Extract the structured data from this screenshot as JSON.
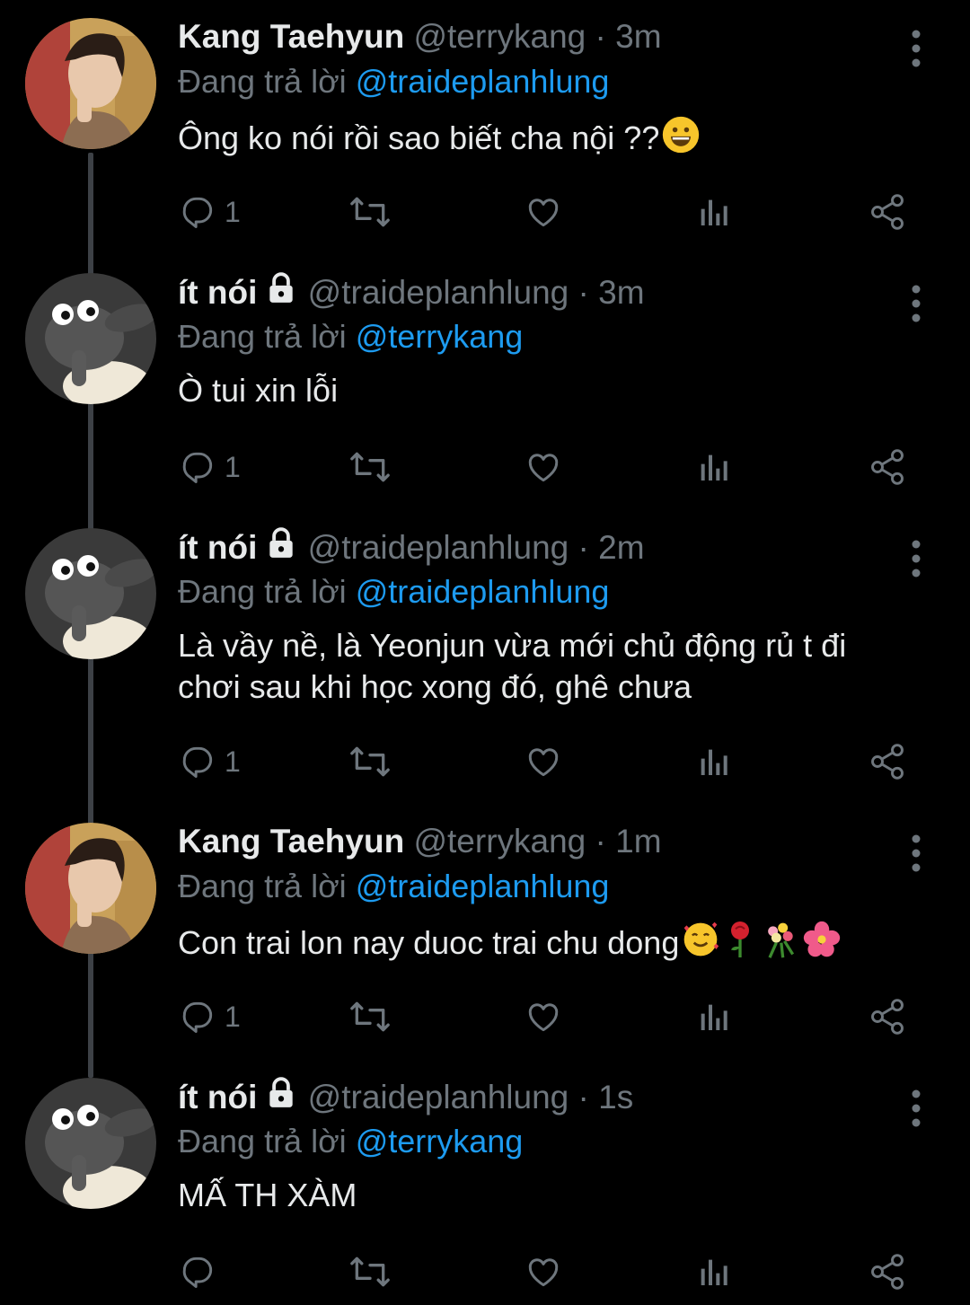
{
  "replying_prefix": "Đang trả lời",
  "tweets": [
    {
      "name": "Kang Taehyun",
      "handle": "@terrykang",
      "time": "3m",
      "replying_to": "@traideplanhlung",
      "text": "Ông ko nói rồi sao biết cha nội ??",
      "reply_count": "1",
      "avatar": "person",
      "locked": false,
      "emojis": [
        "grinning-emoji"
      ]
    },
    {
      "name": "ít nói",
      "handle": "@traideplanhlung",
      "time": "3m",
      "replying_to": "@terrykang",
      "text": "Ò tui xin lỗi",
      "reply_count": "1",
      "avatar": "sheep",
      "locked": true,
      "emojis": []
    },
    {
      "name": "ít nói",
      "handle": "@traideplanhlung",
      "time": "2m",
      "replying_to": "@traideplanhlung",
      "text": "Là vầy nề, là Yeonjun vừa mới chủ động rủ t đi chơi sau khi học xong đó, ghê chưa",
      "reply_count": "1",
      "avatar": "sheep",
      "locked": true,
      "emojis": []
    },
    {
      "name": "Kang Taehyun",
      "handle": "@terrykang",
      "time": "1m",
      "replying_to": "@traideplanhlung",
      "text": "Con trai lon nay duoc trai chu dong",
      "reply_count": "1",
      "avatar": "person",
      "locked": false,
      "emojis": [
        "smiling-hearts-emoji",
        "rose-emoji",
        "bouquet-emoji",
        "hibiscus-emoji"
      ]
    },
    {
      "name": "ít nói",
      "handle": "@traideplanhlung",
      "time": "1s",
      "replying_to": "@terrykang",
      "text": "MẤ TH XÀM",
      "reply_count": "",
      "avatar": "sheep",
      "locked": true,
      "emojis": []
    }
  ],
  "colors": {
    "background": "#000000",
    "text": "#e7e9ea",
    "muted": "#6e767d",
    "link": "#1d9bf0",
    "thread_line": "#3d4146"
  }
}
